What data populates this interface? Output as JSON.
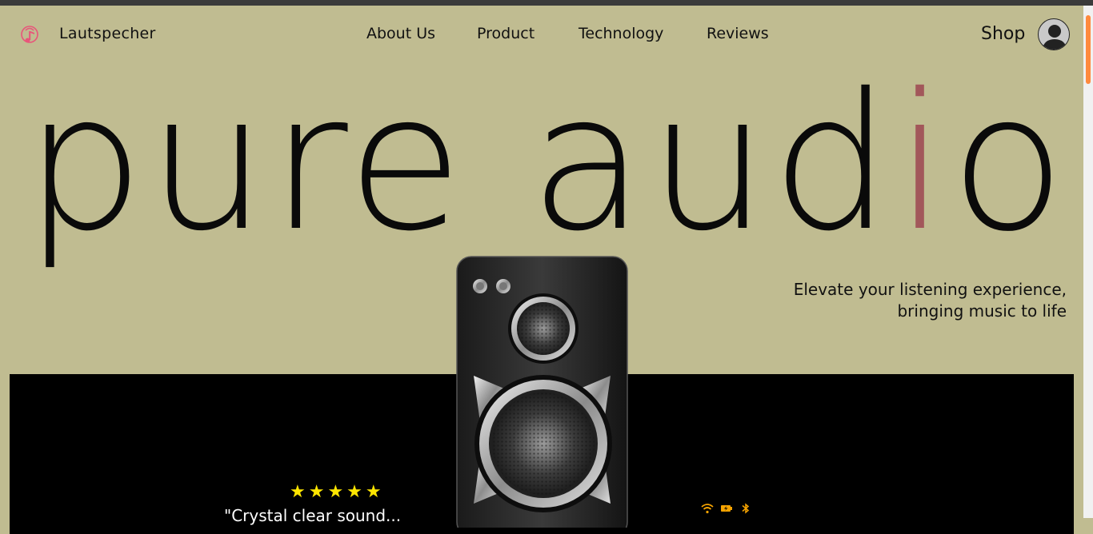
{
  "header": {
    "brand": "Lautspecher",
    "nav": [
      "About Us",
      "Product",
      "Technology",
      "Reviews"
    ],
    "shop": "Shop"
  },
  "hero": {
    "title_main": "pure aud",
    "title_accent": "i",
    "title_end": "o",
    "tagline_line1": "Elevate your listening experience,",
    "tagline_line2": "bringing music to life"
  },
  "review": {
    "stars": "★★★★★",
    "rating": 5,
    "quote": "\"Crystal clear sound..."
  },
  "colors": {
    "background": "#c0bc91",
    "accent": "#a2575a",
    "panel": "#000000",
    "star": "#ffe600",
    "status_icon": "#f5a300",
    "logo": "#e8557a"
  },
  "icons": [
    "music-note-logo-icon",
    "user-avatar-icon",
    "wifi-icon",
    "battery-charging-icon",
    "bluetooth-icon"
  ]
}
